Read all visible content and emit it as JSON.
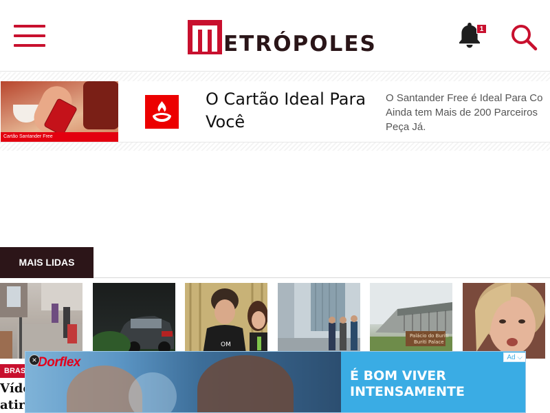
{
  "header": {
    "logo_text": "ETRÓPOLES",
    "notification_count": "1",
    "colors": {
      "brand_red": "#c8102e",
      "brand_dark": "#2a1518"
    },
    "icons": {
      "menu": "hamburger-icon",
      "notifications": "bell-icon",
      "search": "search-icon"
    }
  },
  "promo": {
    "image_caption": "Cartão Santander Free",
    "title": "O Cartão Ideal Para Você",
    "description_lines": [
      "O Santander Free é Ideal Para Co",
      "Ainda tem Mais de 200 Parceiros",
      "Peça Já."
    ],
    "logo_icon": "santander-flame-icon",
    "logo_color": "#ec0000"
  },
  "section": {
    "tab_label": "MAIS LIDAS",
    "tag": "BRASIL",
    "headline_fragment_lines": [
      "Víde",
      "atira"
    ]
  },
  "ad": {
    "brand": "Dorflex",
    "slogan_lines": [
      "É BOM VIVER",
      "INTENSAMENTE"
    ],
    "choice_label": "Ad",
    "close_icon": "close-icon",
    "panel_color": "#3aace4"
  },
  "misc": {
    "edge_glyph": "s"
  }
}
